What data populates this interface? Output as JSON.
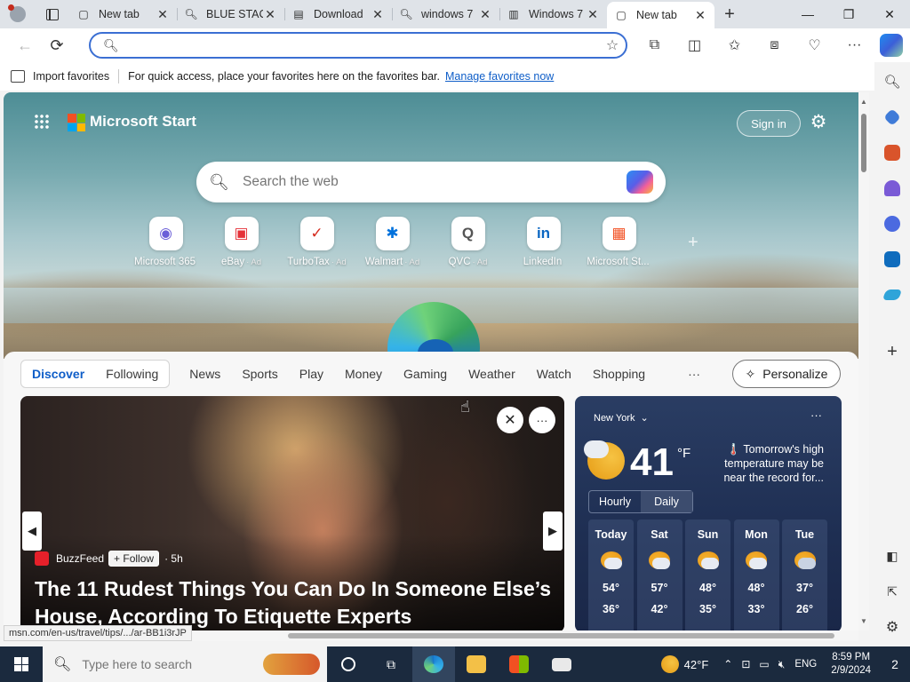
{
  "tabs": [
    {
      "title": "New tab",
      "icon": "newtab-icon",
      "active": false
    },
    {
      "title": "BLUE STACKS",
      "icon": "search-icon",
      "active": false
    },
    {
      "title": "Download",
      "icon": "download-icon",
      "active": false
    },
    {
      "title": "windows 7",
      "icon": "search-icon",
      "active": false
    },
    {
      "title": "Windows 7",
      "icon": "windows-icon",
      "active": false
    },
    {
      "title": "New tab",
      "icon": "newtab-icon",
      "active": true
    }
  ],
  "address": {
    "value": "",
    "placeholder": ""
  },
  "favorites_bar": {
    "import_label": "Import favorites",
    "message": "For quick access, place your favorites here on the favorites bar.",
    "manage_link": "Manage favorites now"
  },
  "start": {
    "brand": "Microsoft Start",
    "sign_in": "Sign in",
    "search_placeholder": "Search the web",
    "quick_links": [
      {
        "label": "Microsoft 365",
        "ad": "",
        "icon": "m365-icon",
        "glyph": "◉",
        "color": "#6b5fd8"
      },
      {
        "label": "eBay",
        "ad": "· Ad",
        "icon": "ebay-icon",
        "glyph": "▣",
        "color": "#e53238"
      },
      {
        "label": "TurboTax",
        "ad": "· Ad",
        "icon": "turbotax-icon",
        "glyph": "✓",
        "color": "#d52b1e"
      },
      {
        "label": "Walmart",
        "ad": "· Ad",
        "icon": "walmart-icon",
        "glyph": "✱",
        "color": "#0071dc"
      },
      {
        "label": "QVC",
        "ad": "· Ad",
        "icon": "qvc-icon",
        "glyph": "Q",
        "color": "#555555"
      },
      {
        "label": "LinkedIn",
        "ad": "",
        "icon": "linkedin-icon",
        "glyph": "in",
        "color": "#0a66c2"
      },
      {
        "label": "Microsoft St...",
        "ad": "",
        "icon": "microsoft-store-icon",
        "glyph": "▦",
        "color": "#f25022"
      }
    ]
  },
  "feed_nav": {
    "segment": [
      "Discover",
      "Following"
    ],
    "items": [
      "News",
      "Sports",
      "Play",
      "Money",
      "Gaming",
      "Weather",
      "Watch",
      "Shopping"
    ],
    "more": "···",
    "personalize": "Personalize"
  },
  "article": {
    "source": "BuzzFeed",
    "follow": "+ Follow",
    "age": "· 5h",
    "headline": "The 11 Rudest Things You Can Do In Someone Else’s House, According To Etiquette Experts"
  },
  "weather": {
    "city": "New York",
    "temp": "41",
    "unit": "°F",
    "alert": "🌡️ Tomorrow's high temperature may be near the record for...",
    "toggle": [
      "Hourly",
      "Daily"
    ],
    "days": [
      {
        "name": "Today",
        "hi": "54°",
        "lo": "36°",
        "rain": false
      },
      {
        "name": "Sat",
        "hi": "57°",
        "lo": "42°",
        "rain": false
      },
      {
        "name": "Sun",
        "hi": "48°",
        "lo": "35°",
        "rain": false
      },
      {
        "name": "Mon",
        "hi": "48°",
        "lo": "33°",
        "rain": false
      },
      {
        "name": "Tue",
        "hi": "37°",
        "lo": "26°",
        "rain": true
      }
    ]
  },
  "status_url": "msn.com/en-us/travel/tips/.../ar-BB1i3rJP",
  "taskbar": {
    "search_placeholder": "Type here to search",
    "weather": "42°F",
    "lang": "ENG",
    "time": "8:59 PM",
    "date": "2/9/2024",
    "notifications": "2"
  }
}
